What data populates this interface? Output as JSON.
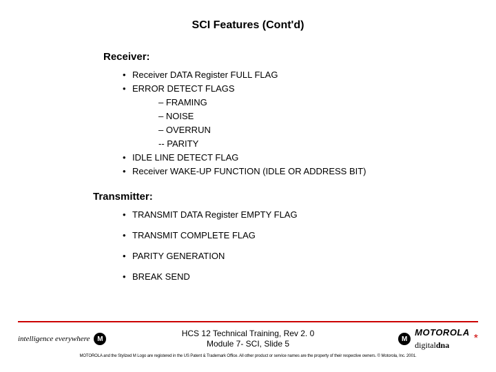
{
  "title": "SCI Features (Cont'd)",
  "receiver": {
    "heading": "Receiver:",
    "items": {
      "0": "Receiver DATA Register FULL FLAG",
      "1": "ERROR DETECT FLAGS",
      "1_sub": {
        "0": "– FRAMING",
        "1": "– NOISE",
        "2": "– OVERRUN",
        "3": "-- PARITY"
      },
      "2": "IDLE LINE DETECT FLAG",
      "3": "Receiver WAKE-UP FUNCTION (IDLE OR ADDRESS BIT)"
    }
  },
  "transmitter": {
    "heading": "Transmitter:",
    "items": {
      "0": "TRANSMIT DATA Register EMPTY FLAG",
      "1": "TRANSMIT COMPLETE FLAG",
      "2": "PARITY GENERATION",
      "3": "BREAK SEND"
    }
  },
  "footer": {
    "line1": "HCS 12 Technical Training,  Rev 2. 0",
    "line2": "Module 7- SCI, Slide 5",
    "left_text": "intelligence  everywhere",
    "m_glyph": "M",
    "moto": "MOTOROLA",
    "dna_digital": "digital",
    "dna_dna": "dna",
    "sun": "*",
    "fineprint": "MOTOROLA and the Stylized M Logo are registered in the US Patent & Trademark Office. All other product or service names are the property of their respective owners.  © Motorola, Inc. 2001."
  }
}
